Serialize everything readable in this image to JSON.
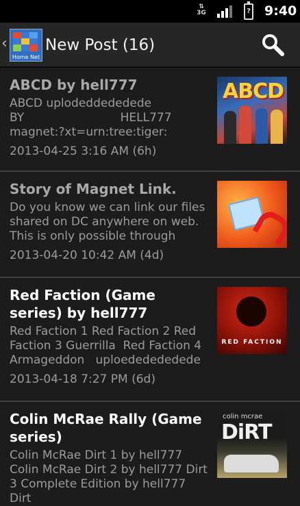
{
  "statusbar": {
    "network": "3G",
    "time": "9:40",
    "battery_glyph": "?"
  },
  "actionbar": {
    "title": "New Post (16)",
    "logo_text": "Home Net",
    "back_glyph": "‹"
  },
  "posts": [
    {
      "title": "ABCD by hell777",
      "snippet": "ABCD uplodeddededede\nBY                          HELL777\nmagnet:?xt=urn:tree:tiger:",
      "date": "2013-04-25 3:16 AM (6h)",
      "thumb_text": "ABCD"
    },
    {
      "title": "Story of Magnet Link.",
      "snippet": "Do you know we can link our files shared on DC anywhere on web. This is only possible through",
      "date": "2013-04-20 10:42 AM (4d)"
    },
    {
      "title": "Red Faction (Game series) by hell777",
      "snippet": "Red Faction 1 Red Faction 2 Red Faction 3 Guerrilla  Red Faction 4 Armageddon   uploededededede",
      "date": "2013-04-18 7:27 PM (6d)",
      "thumb_text": "RED FACTION"
    },
    {
      "title": "Colin McRae Rally (Game series)",
      "snippet": "Colin McRae Dirt 1 by hell777 Colin McRae Dirt 2 by hell777 Dirt 3 Complete Edition by hell777 Dirt",
      "thumb_small": "colin mcrae",
      "thumb_text": "DiRT"
    }
  ]
}
